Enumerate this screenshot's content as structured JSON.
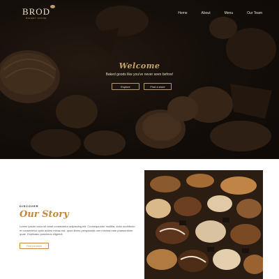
{
  "brand": {
    "name": "BROD",
    "subtitle": "BAKERY HOUSE"
  },
  "nav": [
    {
      "label": "Home"
    },
    {
      "label": "About"
    },
    {
      "label": "Menu"
    },
    {
      "label": "Our Team"
    }
  ],
  "hero": {
    "title": "Welcome",
    "tagline": "Baked goods like you've never seen before!",
    "explore_label": "Explore",
    "store_label": "Find a store"
  },
  "story": {
    "kicker": "DISCOVER",
    "title": "Our Story",
    "body": "Lorem ipsum dolor sit amet consectetur adipiscing elit. Consequuntur mollitia, dolor architecto et consectetur optio autem minus est, quod libero perspiciatis non minima nam praesentium quae. Explicabo possimus eligendi.",
    "button_label": "Find out more"
  },
  "colors": {
    "accent_gold": "#c18a3a",
    "hero_dark": "#1a130d",
    "nav_text": "#e8e2d8"
  }
}
